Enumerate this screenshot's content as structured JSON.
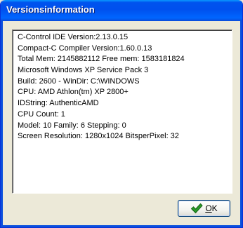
{
  "window": {
    "title": "Versionsinformation"
  },
  "info": {
    "lines": [
      "C-Control IDE Version:2.13.0.15",
      "Compact-C Compiler Version:1.60.0.13",
      "Total Mem: 2145882112  Free mem: 1583181824",
      "Microsoft Windows XP Service Pack 3",
      "Build: 2600 - WinDir: C:\\WINDOWS",
      "CPU: AMD Athlon(tm) XP 2800+",
      "IDString: AuthenticAMD",
      "CPU Count: 1",
      "Model: 10 Family: 6 Stepping: 0",
      "Screen Resolution: 1280x1024  BitsperPixel: 32"
    ]
  },
  "buttons": {
    "ok_mnemonic": "O",
    "ok_rest": "K",
    "ok_icon": "checkmark-icon"
  },
  "colors": {
    "titlebar": "#0054e3",
    "checkmark": "#2a9a2a"
  }
}
